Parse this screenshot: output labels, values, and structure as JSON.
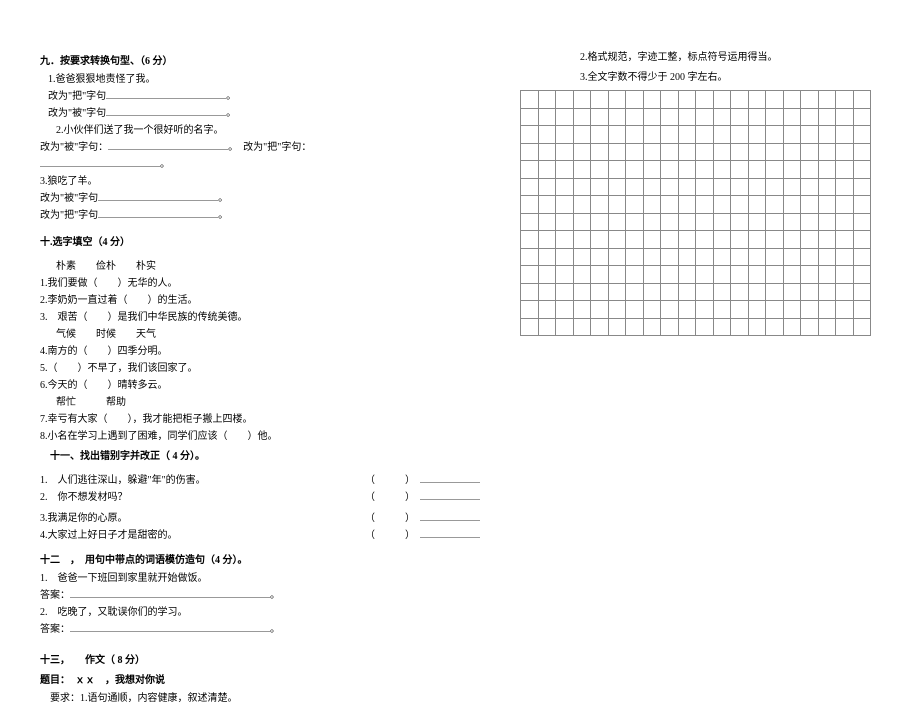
{
  "left": {
    "section9": {
      "title": "九．按要求转换句型、（6 分）",
      "item1": {
        "text": "1.爸爸狠狠地责怪了我。",
        "ba": "改为\"把\"字句",
        "bei": "改为\"被\"字句"
      },
      "item2": {
        "text": "2.小伙伴们送了我一个很好听的名字。",
        "bei": "改为\"被\"字句：",
        "ba": "改为\"把\"字句："
      },
      "item3": {
        "text": "3.狼吃了羊。",
        "bei": "改为\"被\"字句",
        "ba": "改为\"把\"字句"
      }
    },
    "section10": {
      "title": "十.选字填空（4 分）",
      "group1": {
        "words": "朴素　　俭朴　　朴实",
        "q1": "1.我们要做（　　）无华的人。",
        "q2": "2.李奶奶一直过着（　　）的生活。",
        "q3": "3.　艰苦（　　）是我们中华民族的传统美德。"
      },
      "group2": {
        "words": "气候　　时候　　天气",
        "q4": "4.南方的（　　）四季分明。",
        "q5": "5.（　　）不早了，我们该回家了。",
        "q6": "6.今天的（　　）晴转多云。"
      },
      "group3": {
        "words": "帮忙　　　帮助",
        "q7": "7.幸亏有大家（　　），我才能把柜子搬上四楼。",
        "q8": "8.小名在学习上遇到了困难，同学们应该（　　）他。"
      }
    },
    "section11": {
      "title": "　十一、找出错别字并改正（ 4 分）。",
      "q1": "1.　人们逃往深山，躲避\"年\"的伤害。",
      "q2": "2.　你不想发材吗？",
      "q3": "3.我满足你的心原。",
      "q4": "4.大家过上好日子才是甜密的。"
    },
    "section12": {
      "title": "十二　，　用句中带点的词语模仿造句（4 分）。",
      "q1": "1.　爸爸一下班回到家里就开始做饭。",
      "ans": "答案：",
      "q2": "2.　吃晚了，又耽误你们的学习。"
    },
    "section13": {
      "title": "十三，　　作文（ 8 分）",
      "topic": "题目：　ｘｘ　，我想对你说",
      "req1": "　要求：1.语句通顺，内容健康，叙述清楚。"
    }
  },
  "right": {
    "note2": "2.格式规范，字迹工整，标点符号运用得当。",
    "note3": "3.全文字数不得少于 200 字左右。"
  }
}
